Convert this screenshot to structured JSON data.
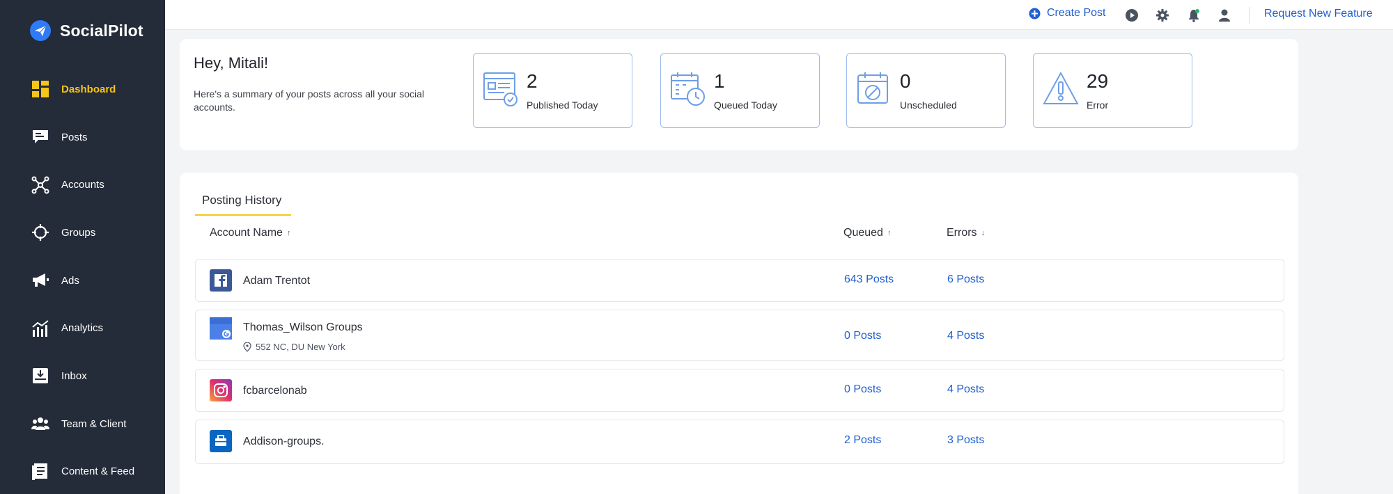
{
  "brand": {
    "name": "SocialPilot"
  },
  "sidebar": {
    "items": [
      {
        "label": "Dashboard",
        "icon": "dashboard-icon",
        "active": true
      },
      {
        "label": "Posts",
        "icon": "posts-icon"
      },
      {
        "label": "Accounts",
        "icon": "accounts-icon"
      },
      {
        "label": "Groups",
        "icon": "groups-icon"
      },
      {
        "label": "Ads",
        "icon": "megaphone-icon"
      },
      {
        "label": "Analytics",
        "icon": "analytics-icon"
      },
      {
        "label": "Inbox",
        "icon": "inbox-icon"
      },
      {
        "label": "Team & Client",
        "icon": "team-icon"
      },
      {
        "label": "Content & Feed",
        "icon": "content-feed-icon"
      }
    ]
  },
  "topbar": {
    "create_post": "Create Post",
    "request_feature": "Request New Feature",
    "icons": [
      "play-icon",
      "gear-icon",
      "notification-bell-icon",
      "user-icon"
    ]
  },
  "summary": {
    "greeting": "Hey, Mitali!",
    "subtitle": "Here's a summary of your posts across all your social accounts.",
    "stats": [
      {
        "value": "2",
        "label": "Published Today",
        "icon": "published-icon"
      },
      {
        "value": "1",
        "label": "Queued Today",
        "icon": "queued-calendar-icon"
      },
      {
        "value": "0",
        "label": "Unscheduled",
        "icon": "unscheduled-calendar-icon"
      },
      {
        "value": "29",
        "label": "Error",
        "icon": "warning-icon"
      }
    ]
  },
  "history": {
    "tab": "Posting History",
    "columns": {
      "account": "Account Name",
      "queued": "Queued",
      "errors": "Errors"
    },
    "rows": [
      {
        "name": "Adam Trentot",
        "platform": "facebook-icon",
        "queued": "643 Posts",
        "errors": "6 Posts"
      },
      {
        "name": "Thomas_Wilson Groups",
        "location": "552 NC, DU New York",
        "platform": "google-business-icon",
        "queued": "0 Posts",
        "errors": "4 Posts"
      },
      {
        "name": "fcbarcelonab",
        "platform": "instagram-icon",
        "queued": "0 Posts",
        "errors": "4 Posts"
      },
      {
        "name": "Addison-groups.",
        "platform": "linkedin-page-icon",
        "queued": "2 Posts",
        "errors": "3 Posts"
      }
    ]
  },
  "colors": {
    "sidebar": "#242b39",
    "accent": "#f5c518",
    "link": "#1f5fd1",
    "stat_border": "#9dbcec"
  }
}
